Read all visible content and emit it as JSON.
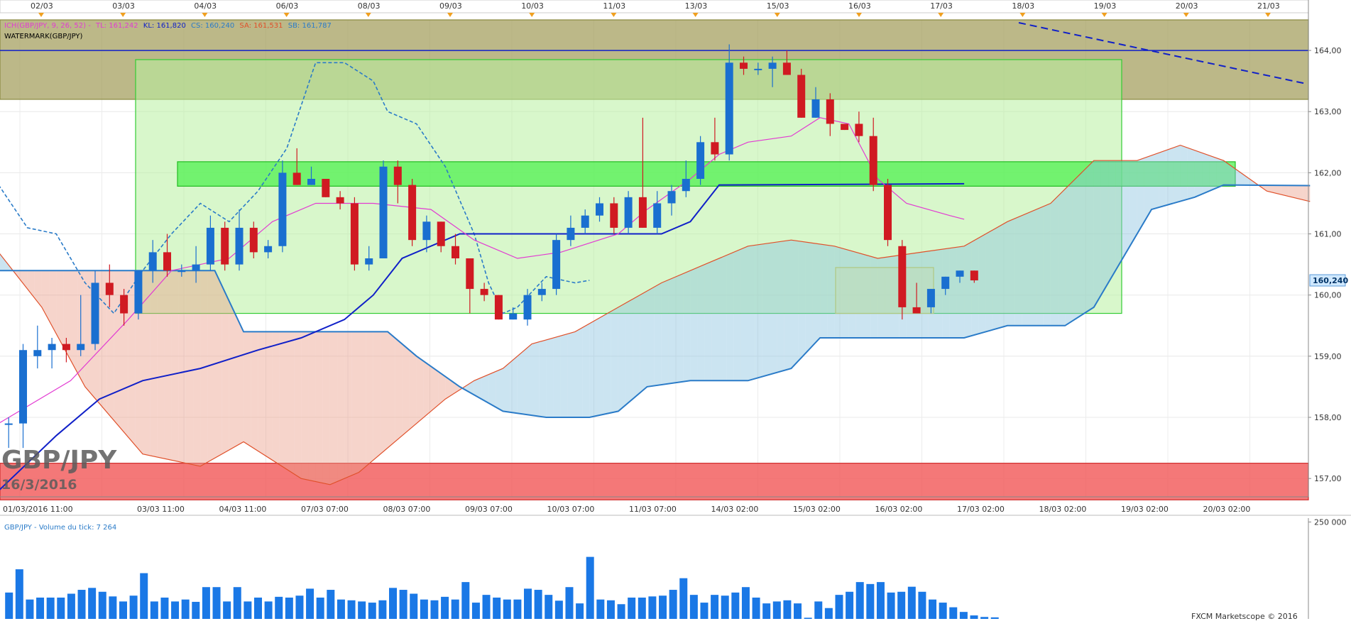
{
  "top_dates": [
    "02/03",
    "03/03",
    "04/03",
    "06/03",
    "08/03",
    "09/03",
    "10/03",
    "11/03",
    "13/03",
    "15/03",
    "16/03",
    "17/03",
    "18/03",
    "19/03",
    "20/03",
    "21/03"
  ],
  "bottom_times": [
    "01/03/2016 11:00",
    "03/03 11:00",
    "04/03 11:00",
    "07/03 07:00",
    "08/03 07:00",
    "09/03 07:00",
    "10/03 07:00",
    "11/03 07:00",
    "14/03 02:00",
    "15/03 02:00",
    "16/03 02:00",
    "17/03 02:00",
    "18/03 02:00",
    "19/03 02:00",
    "20/03 02:00"
  ],
  "legend": {
    "ich_label": "ICH(GBP/JPY, 9, 26, 52) -",
    "tl": "TL: 161,242",
    "kl": "KL: 161,820",
    "cs": "CS: 160,240",
    "sa": "SA: 161,531",
    "sb": "SB: 161,787",
    "watermark_label": "WATERMARK(GBP/JPY)"
  },
  "watermark": {
    "symbol": "GBP/JPY",
    "date": "16/3/2016"
  },
  "price_badge": "160,240",
  "volume_title": "GBP/JPY - Volume du tick: 7 264",
  "copyright": "FXCM Marketscope © 2016",
  "colors": {
    "up": "#1a6fd0",
    "down": "#d01a22",
    "tenkan": "#e23bd2",
    "kijun": "#1020c8",
    "chikou": "#2a7bc8",
    "span_a": "#e0502a",
    "span_b": "#2a7bc8",
    "cloud_bear": "rgba(235,160,140,0.45)",
    "cloud_bull": "rgba(140,195,225,0.45)",
    "zone_top": "#a6a060",
    "zone_red": "#f26060",
    "zone_green": "#b8f0a0",
    "volume": "#1a78e6"
  },
  "chart_data": {
    "type": "candlestick",
    "title": "GBP/JPY",
    "ylabel": "",
    "ylim": [
      156.7,
      164.5
    ],
    "y_ticks": [
      "157,00",
      "158,00",
      "159,00",
      "160,00",
      "161,00",
      "162,00",
      "163,00",
      "164,00"
    ],
    "candles": [
      {
        "o": 157.9,
        "h": 158.0,
        "l": 157.5,
        "c": 157.9
      },
      {
        "o": 157.9,
        "h": 159.2,
        "l": 157.5,
        "c": 159.1
      },
      {
        "o": 159.0,
        "h": 159.5,
        "l": 158.8,
        "c": 159.1
      },
      {
        "o": 159.1,
        "h": 159.3,
        "l": 158.8,
        "c": 159.2
      },
      {
        "o": 159.2,
        "h": 159.3,
        "l": 158.9,
        "c": 159.1
      },
      {
        "o": 159.1,
        "h": 160.0,
        "l": 159.0,
        "c": 159.2
      },
      {
        "o": 159.2,
        "h": 160.4,
        "l": 159.1,
        "c": 160.2
      },
      {
        "o": 160.2,
        "h": 160.5,
        "l": 159.8,
        "c": 160.0
      },
      {
        "o": 160.0,
        "h": 160.1,
        "l": 159.5,
        "c": 159.7
      },
      {
        "o": 159.7,
        "h": 160.4,
        "l": 159.6,
        "c": 160.4
      },
      {
        "o": 160.4,
        "h": 160.9,
        "l": 160.2,
        "c": 160.7
      },
      {
        "o": 160.7,
        "h": 161.0,
        "l": 160.3,
        "c": 160.4
      },
      {
        "o": 160.4,
        "h": 160.5,
        "l": 160.3,
        "c": 160.4
      },
      {
        "o": 160.4,
        "h": 160.8,
        "l": 160.2,
        "c": 160.5
      },
      {
        "o": 160.5,
        "h": 161.3,
        "l": 160.4,
        "c": 161.1
      },
      {
        "o": 161.1,
        "h": 161.2,
        "l": 160.4,
        "c": 160.5
      },
      {
        "o": 160.5,
        "h": 161.4,
        "l": 160.4,
        "c": 161.1
      },
      {
        "o": 161.1,
        "h": 161.2,
        "l": 160.6,
        "c": 160.7
      },
      {
        "o": 160.7,
        "h": 160.9,
        "l": 160.6,
        "c": 160.8
      },
      {
        "o": 160.8,
        "h": 162.2,
        "l": 160.7,
        "c": 162.0
      },
      {
        "o": 162.0,
        "h": 162.4,
        "l": 161.8,
        "c": 161.8
      },
      {
        "o": 161.8,
        "h": 162.1,
        "l": 161.8,
        "c": 161.9
      },
      {
        "o": 161.9,
        "h": 161.9,
        "l": 161.6,
        "c": 161.6
      },
      {
        "o": 161.6,
        "h": 161.7,
        "l": 161.4,
        "c": 161.5
      },
      {
        "o": 161.5,
        "h": 161.6,
        "l": 160.4,
        "c": 160.5
      },
      {
        "o": 160.5,
        "h": 160.8,
        "l": 160.4,
        "c": 160.6
      },
      {
        "o": 160.6,
        "h": 162.2,
        "l": 160.6,
        "c": 162.1
      },
      {
        "o": 162.1,
        "h": 162.2,
        "l": 161.5,
        "c": 161.8
      },
      {
        "o": 161.8,
        "h": 161.9,
        "l": 160.8,
        "c": 160.9
      },
      {
        "o": 160.9,
        "h": 161.3,
        "l": 160.7,
        "c": 161.2
      },
      {
        "o": 161.2,
        "h": 161.2,
        "l": 160.7,
        "c": 160.8
      },
      {
        "o": 160.8,
        "h": 161.0,
        "l": 160.5,
        "c": 160.6
      },
      {
        "o": 160.6,
        "h": 160.6,
        "l": 159.7,
        "c": 160.1
      },
      {
        "o": 160.1,
        "h": 160.2,
        "l": 159.9,
        "c": 160.0
      },
      {
        "o": 160.0,
        "h": 160.0,
        "l": 159.6,
        "c": 159.6
      },
      {
        "o": 159.6,
        "h": 159.8,
        "l": 159.6,
        "c": 159.7
      },
      {
        "o": 159.6,
        "h": 160.1,
        "l": 159.5,
        "c": 160.0
      },
      {
        "o": 160.0,
        "h": 160.2,
        "l": 159.9,
        "c": 160.1
      },
      {
        "o": 160.1,
        "h": 161.0,
        "l": 160.0,
        "c": 160.9
      },
      {
        "o": 160.9,
        "h": 161.3,
        "l": 160.8,
        "c": 161.1
      },
      {
        "o": 161.1,
        "h": 161.4,
        "l": 161.0,
        "c": 161.3
      },
      {
        "o": 161.3,
        "h": 161.6,
        "l": 161.2,
        "c": 161.5
      },
      {
        "o": 161.5,
        "h": 161.6,
        "l": 161.0,
        "c": 161.1
      },
      {
        "o": 161.1,
        "h": 161.7,
        "l": 161.0,
        "c": 161.6
      },
      {
        "o": 161.6,
        "h": 162.9,
        "l": 161.1,
        "c": 161.1
      },
      {
        "o": 161.1,
        "h": 161.7,
        "l": 161.0,
        "c": 161.5
      },
      {
        "o": 161.5,
        "h": 161.8,
        "l": 161.3,
        "c": 161.7
      },
      {
        "o": 161.7,
        "h": 162.2,
        "l": 161.6,
        "c": 161.9
      },
      {
        "o": 161.9,
        "h": 162.6,
        "l": 161.8,
        "c": 162.5
      },
      {
        "o": 162.5,
        "h": 162.9,
        "l": 162.2,
        "c": 162.3
      },
      {
        "o": 162.3,
        "h": 164.1,
        "l": 162.2,
        "c": 163.8
      },
      {
        "o": 163.8,
        "h": 163.9,
        "l": 163.6,
        "c": 163.7
      },
      {
        "o": 163.7,
        "h": 163.8,
        "l": 163.6,
        "c": 163.7
      },
      {
        "o": 163.7,
        "h": 163.9,
        "l": 163.4,
        "c": 163.8
      },
      {
        "o": 163.8,
        "h": 164.0,
        "l": 163.6,
        "c": 163.6
      },
      {
        "o": 163.6,
        "h": 163.7,
        "l": 162.9,
        "c": 162.9
      },
      {
        "o": 162.9,
        "h": 163.4,
        "l": 162.9,
        "c": 163.2
      },
      {
        "o": 163.2,
        "h": 163.3,
        "l": 162.6,
        "c": 162.8
      },
      {
        "o": 162.8,
        "h": 162.8,
        "l": 162.7,
        "c": 162.7
      },
      {
        "o": 162.8,
        "h": 163.0,
        "l": 162.5,
        "c": 162.6
      },
      {
        "o": 162.6,
        "h": 162.9,
        "l": 161.7,
        "c": 161.8
      },
      {
        "o": 161.8,
        "h": 161.9,
        "l": 160.8,
        "c": 160.9
      },
      {
        "o": 160.8,
        "h": 160.9,
        "l": 159.6,
        "c": 159.8
      },
      {
        "o": 159.8,
        "h": 160.2,
        "l": 159.7,
        "c": 159.7
      },
      {
        "o": 159.8,
        "h": 160.1,
        "l": 159.7,
        "c": 160.1
      },
      {
        "o": 160.1,
        "h": 160.3,
        "l": 160.0,
        "c": 160.3
      },
      {
        "o": 160.3,
        "h": 160.4,
        "l": 160.2,
        "c": 160.4
      },
      {
        "o": 160.4,
        "h": 160.4,
        "l": 160.2,
        "c": 160.24
      }
    ],
    "tenkan": [
      [
        0,
        157.9
      ],
      [
        5,
        158.6
      ],
      [
        9,
        159.6
      ],
      [
        12,
        160.4
      ],
      [
        16,
        160.6
      ],
      [
        19,
        161.2
      ],
      [
        22,
        161.5
      ],
      [
        26,
        161.5
      ],
      [
        30,
        161.4
      ],
      [
        33,
        160.9
      ],
      [
        36,
        160.6
      ],
      [
        39,
        160.7
      ],
      [
        43,
        161.0
      ],
      [
        45,
        161.4
      ],
      [
        48,
        161.9
      ],
      [
        50,
        162.3
      ],
      [
        52,
        162.5
      ],
      [
        55,
        162.6
      ],
      [
        57,
        162.9
      ],
      [
        59,
        162.8
      ],
      [
        61,
        161.9
      ],
      [
        63,
        161.5
      ],
      [
        66,
        161.3
      ],
      [
        67,
        161.24
      ]
    ],
    "kijun": [
      [
        0,
        156.8
      ],
      [
        4,
        157.7
      ],
      [
        7,
        158.3
      ],
      [
        10,
        158.6
      ],
      [
        14,
        158.8
      ],
      [
        18,
        159.1
      ],
      [
        21,
        159.3
      ],
      [
        24,
        159.6
      ],
      [
        26,
        160.0
      ],
      [
        28,
        160.6
      ],
      [
        32,
        161.0
      ],
      [
        36,
        161.0
      ],
      [
        46,
        161.0
      ],
      [
        48,
        161.2
      ],
      [
        50,
        161.8
      ],
      [
        67,
        161.82
      ]
    ],
    "chikou": [
      [
        0,
        161.8
      ],
      [
        2,
        161.1
      ],
      [
        4,
        161.0
      ],
      [
        6,
        160.2
      ],
      [
        8,
        159.7
      ],
      [
        10,
        160.4
      ],
      [
        12,
        161.0
      ],
      [
        14,
        161.5
      ],
      [
        16,
        161.2
      ],
      [
        18,
        161.7
      ],
      [
        20,
        162.4
      ],
      [
        22,
        163.8
      ],
      [
        24,
        163.8
      ],
      [
        26,
        163.5
      ],
      [
        27,
        163.0
      ],
      [
        29,
        162.8
      ],
      [
        31,
        162.1
      ],
      [
        33,
        161.0
      ],
      [
        34,
        160.2
      ],
      [
        35,
        159.7
      ],
      [
        36,
        159.8
      ],
      [
        38,
        160.3
      ],
      [
        40,
        160.2
      ],
      [
        41,
        160.24
      ]
    ],
    "span_a": [
      [
        0,
        160.7
      ],
      [
        3,
        159.8
      ],
      [
        6,
        158.5
      ],
      [
        10,
        157.4
      ],
      [
        14,
        157.2
      ],
      [
        17,
        157.6
      ],
      [
        21,
        157.0
      ],
      [
        23,
        156.9
      ],
      [
        25,
        157.1
      ],
      [
        28,
        157.7
      ],
      [
        31,
        158.3
      ],
      [
        33,
        158.6
      ],
      [
        35,
        158.8
      ],
      [
        37,
        159.2
      ],
      [
        40,
        159.4
      ],
      [
        43,
        159.8
      ],
      [
        46,
        160.2
      ],
      [
        49,
        160.5
      ],
      [
        52,
        160.8
      ],
      [
        55,
        160.9
      ],
      [
        58,
        160.8
      ],
      [
        61,
        160.6
      ],
      [
        64,
        160.7
      ],
      [
        67,
        160.8
      ],
      [
        70,
        161.2
      ],
      [
        73,
        161.5
      ],
      [
        76,
        162.2
      ],
      [
        79,
        162.2
      ],
      [
        82,
        162.45
      ],
      [
        85,
        162.2
      ],
      [
        88,
        161.7
      ],
      [
        91,
        161.53
      ]
    ],
    "span_b": [
      [
        0,
        160.4
      ],
      [
        15,
        160.4
      ],
      [
        17,
        159.4
      ],
      [
        27,
        159.4
      ],
      [
        29,
        159.0
      ],
      [
        32,
        158.5
      ],
      [
        35,
        158.1
      ],
      [
        38,
        158.0
      ],
      [
        41,
        158.0
      ],
      [
        43,
        158.1
      ],
      [
        45,
        158.5
      ],
      [
        48,
        158.6
      ],
      [
        52,
        158.6
      ],
      [
        55,
        158.8
      ],
      [
        57,
        159.3
      ],
      [
        60,
        159.3
      ],
      [
        67,
        159.3
      ],
      [
        70,
        159.5
      ],
      [
        74,
        159.5
      ],
      [
        76,
        159.8
      ],
      [
        78,
        160.6
      ],
      [
        80,
        161.4
      ],
      [
        83,
        161.6
      ],
      [
        85,
        161.8
      ],
      [
        91,
        161.79
      ]
    ],
    "zones": [
      {
        "name": "resistance-band",
        "ymin": 163.2,
        "ymax": 164.5
      },
      {
        "name": "support-band",
        "ymin": 156.65,
        "ymax": 157.25
      },
      {
        "name": "range-box",
        "ymin": 159.7,
        "ymax": 163.85
      },
      {
        "name": "pivot-band",
        "ymin": 161.78,
        "ymax": 162.18
      },
      {
        "name": "consolidation-box",
        "ymin": 159.7,
        "ymax": 160.45
      }
    ],
    "horizontal_line": 164.0,
    "volume": {
      "ylim": [
        0,
        260000
      ],
      "y_ticks": [
        "250 000"
      ],
      "values": [
        68000,
        128000,
        50000,
        55000,
        55000,
        55000,
        65000,
        75000,
        80000,
        70000,
        58000,
        45000,
        60000,
        118000,
        45000,
        55000,
        45000,
        50000,
        44000,
        82000,
        82000,
        45000,
        82000,
        45000,
        55000,
        45000,
        57000,
        55000,
        60000,
        78000,
        55000,
        75000,
        50000,
        48000,
        45000,
        42000,
        48000,
        80000,
        75000,
        65000,
        50000,
        48000,
        57000,
        50000,
        95000,
        42000,
        62000,
        55000,
        50000,
        50000,
        78000,
        75000,
        62000,
        47000,
        82000,
        40000,
        160000,
        50000,
        48000,
        38000,
        55000,
        55000,
        58000,
        60000,
        75000,
        105000,
        62000,
        42000,
        62000,
        60000,
        68000,
        82000,
        55000,
        40000,
        45000,
        48000,
        40000,
        3000,
        45000,
        28000,
        62000,
        70000,
        95000,
        90000,
        95000,
        68000,
        70000,
        83000,
        70000,
        50000,
        42000,
        30000,
        18000,
        9000,
        5000,
        4000
      ]
    }
  }
}
